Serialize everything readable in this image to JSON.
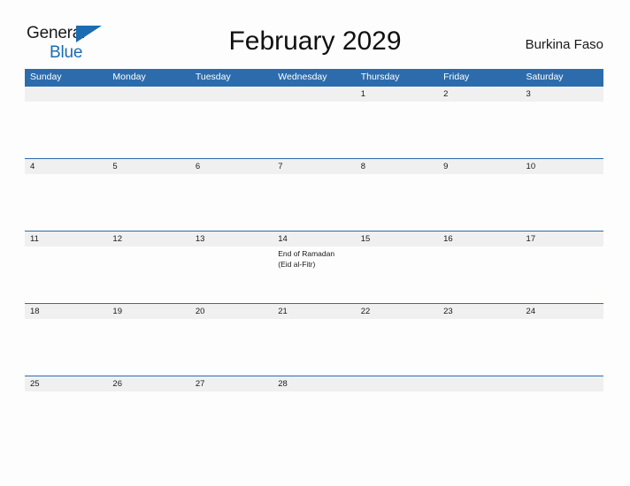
{
  "logo": {
    "word_1": "General",
    "word_2": "Blue",
    "triangle_icon": "triangle-icon",
    "brand_color": "#1B6CB0"
  },
  "header": {
    "title": "February 2029",
    "country": "Burkina Faso"
  },
  "calendar": {
    "header_color": "#2D6CAC",
    "date_strip_color": "#F0F0F0",
    "weekdays": [
      "Sunday",
      "Monday",
      "Tuesday",
      "Wednesday",
      "Thursday",
      "Friday",
      "Saturday"
    ],
    "weeks": [
      [
        {
          "day": "",
          "event": ""
        },
        {
          "day": "",
          "event": ""
        },
        {
          "day": "",
          "event": ""
        },
        {
          "day": "",
          "event": ""
        },
        {
          "day": "1",
          "event": ""
        },
        {
          "day": "2",
          "event": ""
        },
        {
          "day": "3",
          "event": ""
        }
      ],
      [
        {
          "day": "4",
          "event": ""
        },
        {
          "day": "5",
          "event": ""
        },
        {
          "day": "6",
          "event": ""
        },
        {
          "day": "7",
          "event": ""
        },
        {
          "day": "8",
          "event": ""
        },
        {
          "day": "9",
          "event": ""
        },
        {
          "day": "10",
          "event": ""
        }
      ],
      [
        {
          "day": "11",
          "event": ""
        },
        {
          "day": "12",
          "event": ""
        },
        {
          "day": "13",
          "event": ""
        },
        {
          "day": "14",
          "event": "End of Ramadan\n(Eid al-Fitr)"
        },
        {
          "day": "15",
          "event": ""
        },
        {
          "day": "16",
          "event": ""
        },
        {
          "day": "17",
          "event": ""
        }
      ],
      [
        {
          "day": "18",
          "event": ""
        },
        {
          "day": "19",
          "event": ""
        },
        {
          "day": "20",
          "event": ""
        },
        {
          "day": "21",
          "event": ""
        },
        {
          "day": "22",
          "event": ""
        },
        {
          "day": "23",
          "event": ""
        },
        {
          "day": "24",
          "event": ""
        }
      ],
      [
        {
          "day": "25",
          "event": ""
        },
        {
          "day": "26",
          "event": ""
        },
        {
          "day": "27",
          "event": ""
        },
        {
          "day": "28",
          "event": ""
        },
        {
          "day": "",
          "event": ""
        },
        {
          "day": "",
          "event": ""
        },
        {
          "day": "",
          "event": ""
        }
      ]
    ]
  }
}
